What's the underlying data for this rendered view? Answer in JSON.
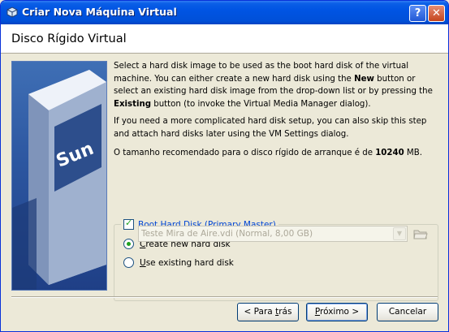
{
  "window": {
    "title": "Criar Nova Máquina Virtual",
    "help_button": "?",
    "close_button": "✕"
  },
  "header": {
    "title": "Disco Rígido Virtual"
  },
  "description": {
    "p1_a": "Select a hard disk image to be used as the boot hard disk of the virtual machine. You can either create a new hard disk using the ",
    "p1_new": "New",
    "p1_b": " button or select an existing hard disk image from the drop-down list or by pressing the ",
    "p1_existing": "Existing",
    "p1_c": " button (to invoke the Virtual Media Manager dialog).",
    "p2": "If you need a more complicated hard disk setup, you can also skip this step and attach hard disks later using the VM Settings dialog.",
    "p3_a": "O tamanho recomendado para o disco rígido de arranque é de ",
    "p3_size": "10240",
    "p3_b": " MB."
  },
  "boot_disk": {
    "checkbox_label_pre": "Boot Hard ",
    "checkbox_label_u": "D",
    "checkbox_label_post": "isk (Primary Master)",
    "checked": true,
    "create_new_u": "C",
    "create_new_rest": "reate new hard disk",
    "create_new_selected": true,
    "use_existing_u": "U",
    "use_existing_rest": "se existing hard disk",
    "use_existing_selected": false,
    "existing_disk_value": "Teste Mira de Aire.vdi (Normal, 8,00 GB)"
  },
  "buttons": {
    "back_pre": "< Para ",
    "back_u": "t",
    "back_post": "rás",
    "next_u": "P",
    "next_rest": "róximo >",
    "cancel": "Cancelar"
  },
  "colors": {
    "titlebar": "#0054e3",
    "legend_text": "#0046d5",
    "check_green": "#21a121"
  }
}
